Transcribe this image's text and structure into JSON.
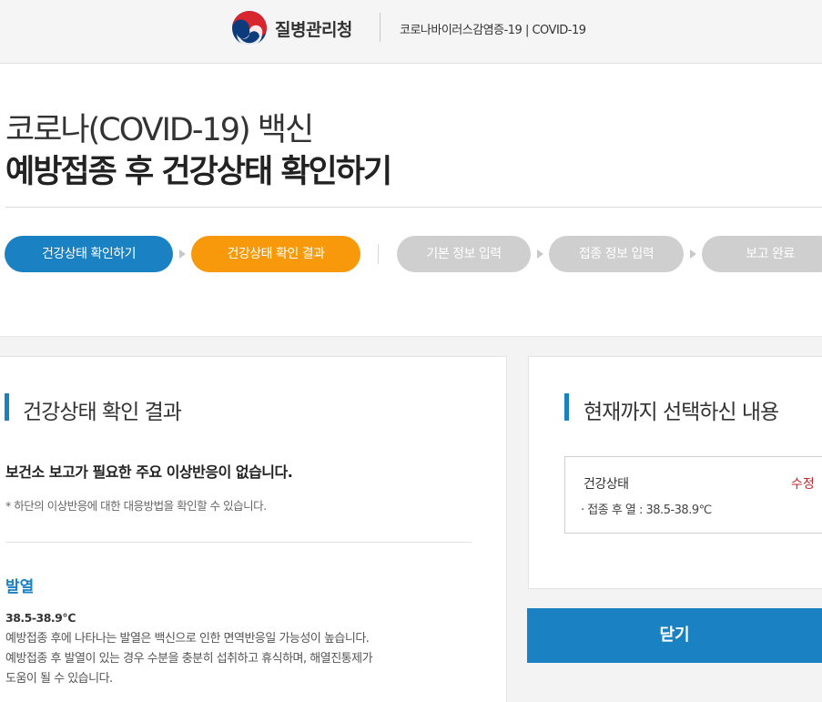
{
  "header": {
    "logo_text": "질병관리청",
    "subtitle": "코로나바이러스감염증-19 | COVID-19"
  },
  "title": {
    "line1": "코로나(COVID-19) 백신",
    "line2": "예방접종 후 건강상태 확인하기"
  },
  "steps": [
    {
      "label": "건강상태 확인하기",
      "state": "done"
    },
    {
      "label": "건강상태 확인 결과",
      "state": "active"
    },
    {
      "label": "기본 정보 입력",
      "state": "todo"
    },
    {
      "label": "접종 정보 입력",
      "state": "todo"
    },
    {
      "label": "보고 완료",
      "state": "todo"
    }
  ],
  "result": {
    "section_title": "건강상태 확인 결과",
    "main_message": "보건소 보고가 필요한 주요 이상반응이 없습니다.",
    "note": "* 하단의 이상반응에 대한 대응방법을 확인할 수 있습니다.",
    "symptom": {
      "title": "발열",
      "range": "38.5-38.9℃",
      "desc_lines": [
        "예방접종 후에 나타나는 발열은 백신으로 인한 면역반응일 가능성이 높습니다.",
        "예방접종 후 발열이 있는 경우 수분을 충분히 섭취하고 휴식하며, 해열진통제가",
        "도움이 될 수 있습니다."
      ]
    }
  },
  "summary": {
    "section_title": "현재까지 선택하신 내용",
    "label": "건강상태",
    "edit_label": "수정",
    "item": "· 접종 후 열 : 38.5-38.9℃"
  },
  "close_label": "닫기",
  "colors": {
    "primary": "#1a82c3",
    "active_step": "#f7990b",
    "inactive_step": "#cfcfcf",
    "edit": "#c0282d"
  },
  "icons": {
    "logo": "kdca-taegeuk-logo"
  }
}
